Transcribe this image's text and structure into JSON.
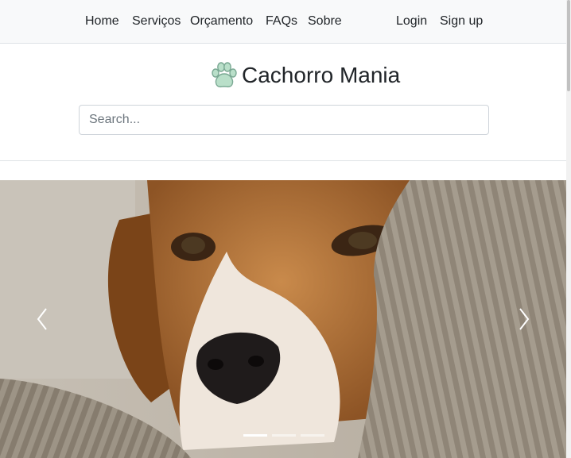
{
  "nav": {
    "home": "Home",
    "services": "Serviços",
    "quote": "Orçamento",
    "faqs": "FAQs",
    "about": "Sobre",
    "login": "Login",
    "signup": "Sign up"
  },
  "brand": {
    "title": "Cachorro Mania",
    "icon": "paw-icon"
  },
  "search": {
    "placeholder": "Search..."
  },
  "carousel": {
    "slide_count": 3,
    "active_index": 0
  },
  "colors": {
    "paw": "#b9dfc9",
    "paw_stroke": "#7aa893"
  }
}
